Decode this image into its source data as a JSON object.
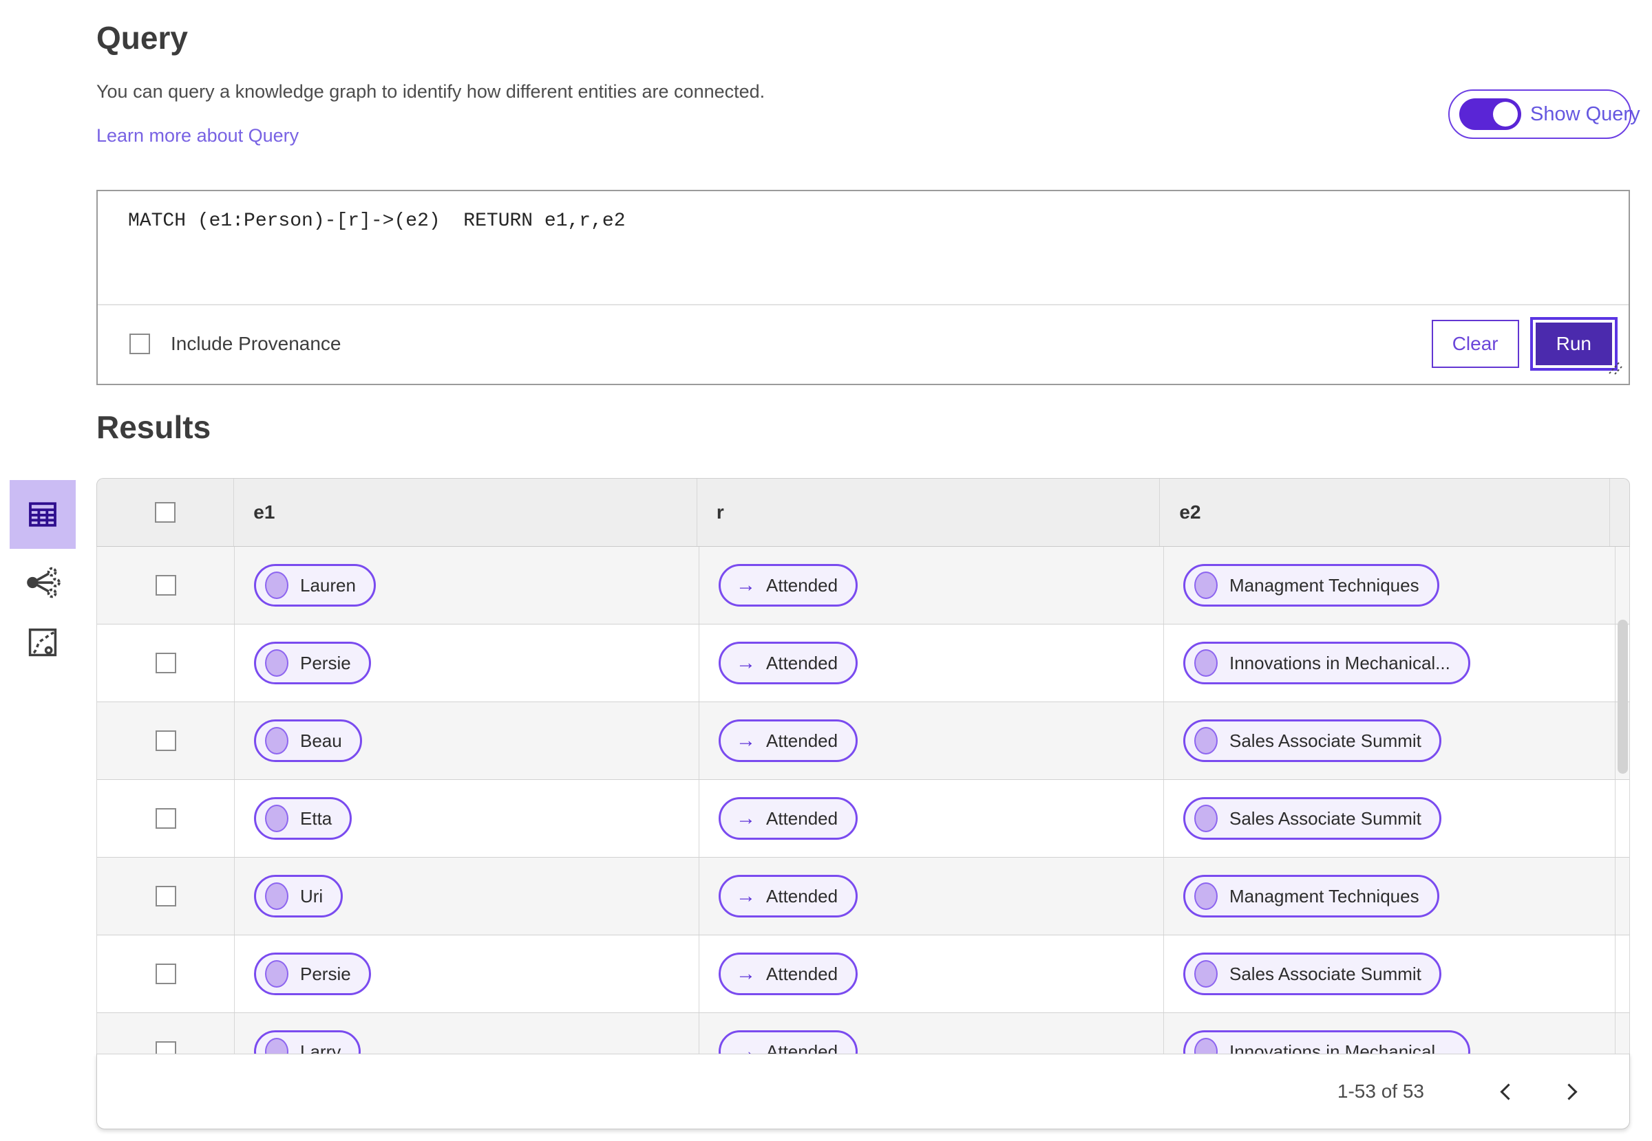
{
  "colors": {
    "accent_purple": "#5b35e3",
    "run_button_fill": "#4b2aad",
    "toggle_track": "#5a25d6",
    "link_purple": "#7862e3",
    "pill_border": "#7a4bef",
    "pill_background": "#f4f1fd",
    "pill_node_fill": "#c8b2f2",
    "selected_tile_background": "#cbbcf4",
    "selected_tile_icon": "#2f0e8e",
    "table_header_background": "#eeeeee",
    "row_alternate_background": "#f5f5f5"
  },
  "icons": {
    "relation_arrow": "→"
  },
  "query_section": {
    "title": "Query",
    "description": "You can query a knowledge graph to identify how different entities are connected.",
    "learn_more_link": "Learn more about Query",
    "show_query_toggle": {
      "label": "Show Query",
      "state": "on"
    },
    "query_text": "MATCH (e1:Person)-[r]->(e2)  RETURN e1,r,e2",
    "include_provenance": {
      "label": "Include Provenance",
      "checked": false
    },
    "clear_button": "Clear",
    "run_button": "Run"
  },
  "results_section": {
    "title": "Results",
    "view_rail": [
      {
        "name": "table-view",
        "selected": true
      },
      {
        "name": "network-view",
        "selected": false
      },
      {
        "name": "chart-view",
        "selected": false
      }
    ],
    "table": {
      "columns": {
        "e1": "e1",
        "r": "r",
        "e2": "e2"
      },
      "rows": [
        {
          "e1": "Lauren",
          "r": "Attended",
          "e2": "Managment Techniques"
        },
        {
          "e1": "Persie",
          "r": "Attended",
          "e2": "Innovations in Mechanical..."
        },
        {
          "e1": "Beau",
          "r": "Attended",
          "e2": "Sales Associate Summit"
        },
        {
          "e1": "Etta",
          "r": "Attended",
          "e2": "Sales Associate Summit"
        },
        {
          "e1": "Uri",
          "r": "Attended",
          "e2": "Managment Techniques"
        },
        {
          "e1": "Persie",
          "r": "Attended",
          "e2": "Sales Associate Summit"
        },
        {
          "e1": "Larry",
          "r": "Attended",
          "e2": "Innovations in Mechanical..."
        }
      ],
      "pagination": {
        "range_label": "1-53 of 53"
      }
    }
  }
}
